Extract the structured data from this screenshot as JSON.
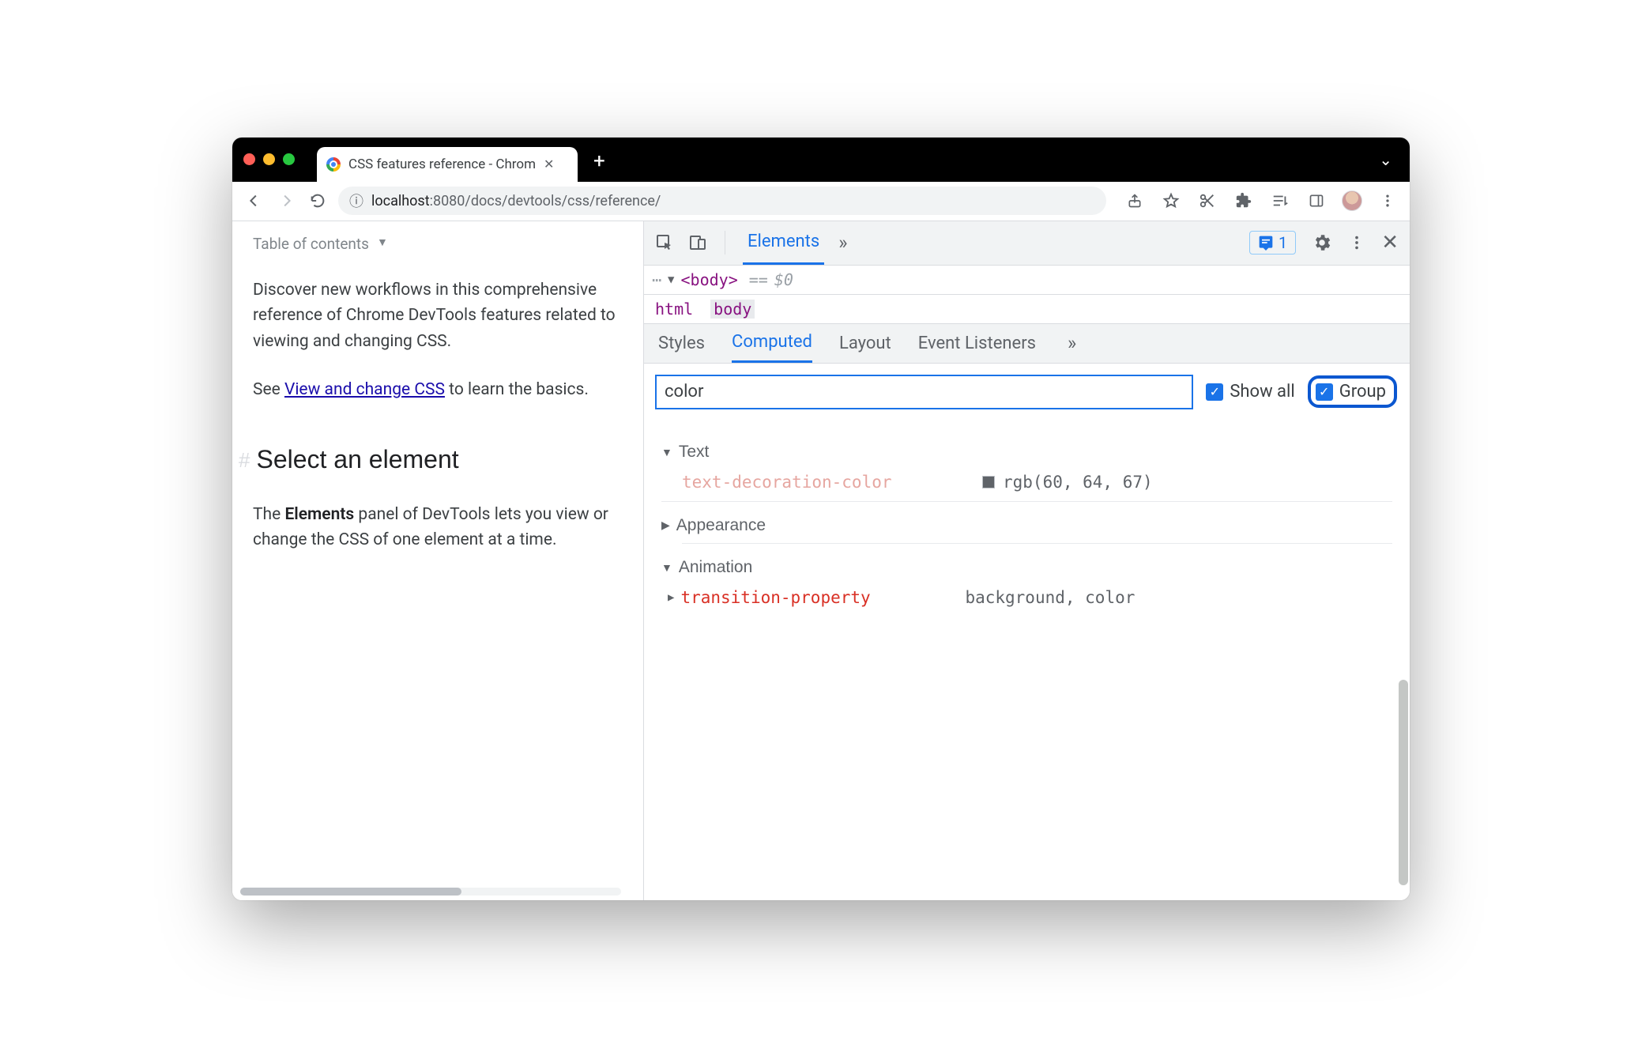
{
  "tab": {
    "title": "CSS features reference - Chrom"
  },
  "tabstrip": {
    "caret": "⌄"
  },
  "toolbar": {
    "url_host": "localhost",
    "url_port": ":8080",
    "url_path": "/docs/devtools/css/reference/"
  },
  "page": {
    "toc": "Table of contents",
    "p1": "Discover new workflows in this comprehensive reference of Chrome DevTools features related to viewing and changing CSS.",
    "p2a": "See ",
    "p2link": "View and change CSS",
    "p2b": " to learn the basics.",
    "h2": "Select an element",
    "p3a": "The ",
    "p3bold": "Elements",
    "p3b": " panel of DevTools lets you view or change the CSS of one element at a time."
  },
  "devtools": {
    "header": {
      "tab_elements": "Elements",
      "issues": "1"
    },
    "tree": {
      "tag": "<body>",
      "eq": "==",
      "var": "$0"
    },
    "crumbs": {
      "c1": "html",
      "c2": "body"
    },
    "subtabs": {
      "styles": "Styles",
      "computed": "Computed",
      "layout": "Layout",
      "listeners": "Event Listeners"
    },
    "filter": {
      "value": "color",
      "showall": "Show all",
      "group": "Group"
    },
    "groups": {
      "g1": {
        "name": "Text",
        "prop": "text-decoration-color",
        "val": "rgb(60, 64, 67)"
      },
      "g2": {
        "name": "Appearance"
      },
      "g3": {
        "name": "Animation",
        "prop": "transition-property",
        "val": "background, color"
      }
    }
  }
}
